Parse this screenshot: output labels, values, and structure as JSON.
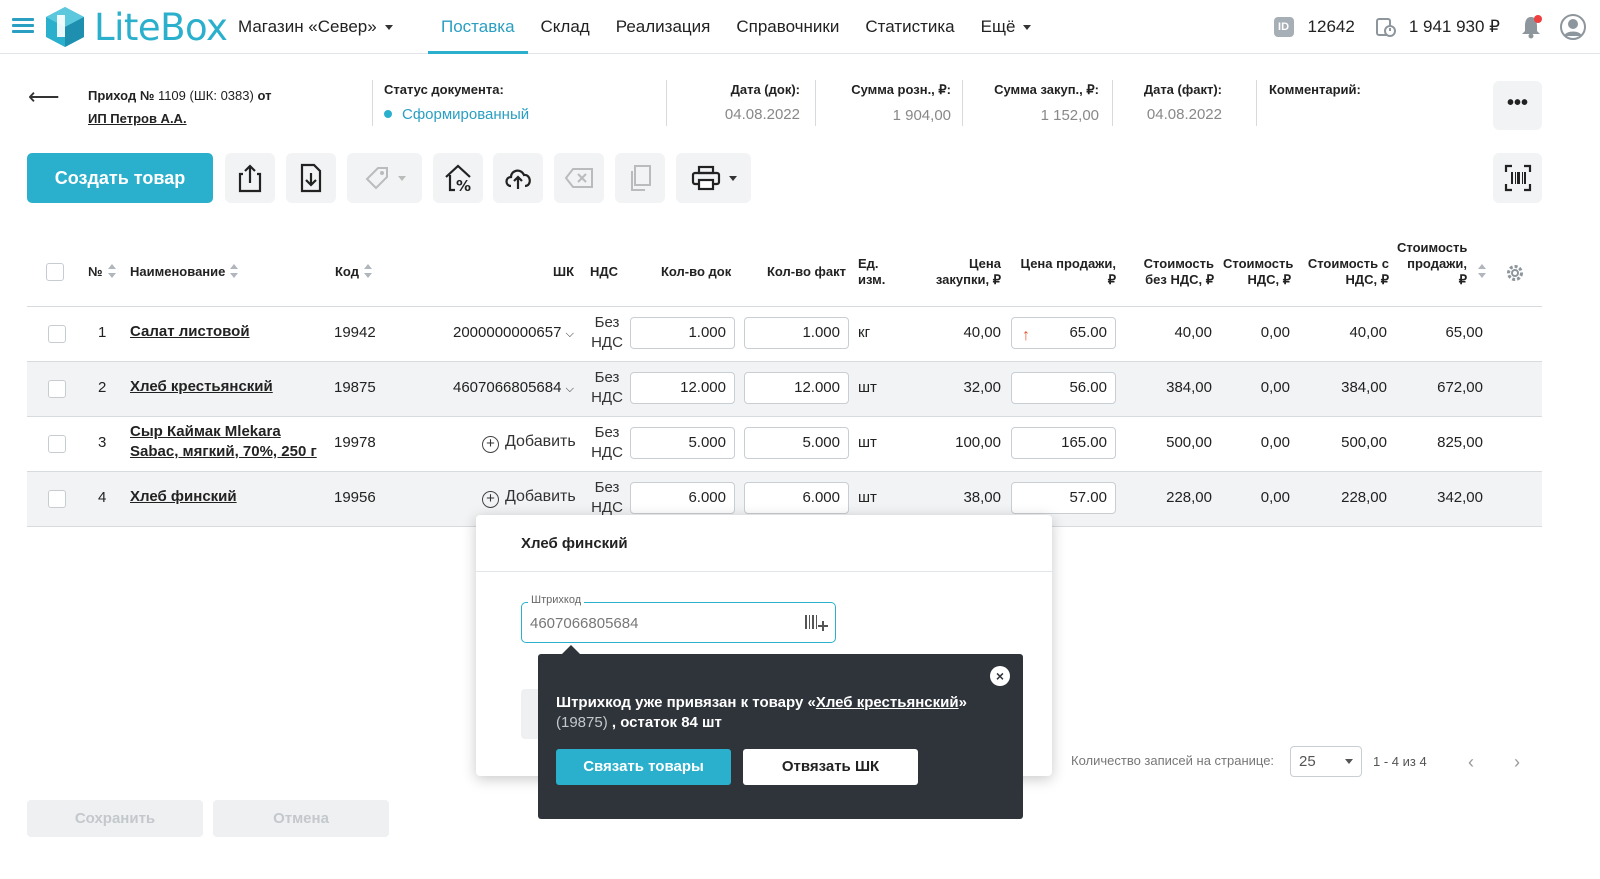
{
  "app": {
    "logo_text": "LiteBox",
    "store": "Магазин «Север»",
    "nav": [
      {
        "label": "Поставка",
        "active": true
      },
      {
        "label": "Склад"
      },
      {
        "label": "Реализация"
      },
      {
        "label": "Справочники"
      },
      {
        "label": "Статистика"
      },
      {
        "label": "Ещё"
      }
    ],
    "id_badge": "ID",
    "account_id": "12642",
    "balance": "1 941 930 ₽",
    "accent_color": "#2ab0cc"
  },
  "document": {
    "title_prefix": "Приход №",
    "number": "1109",
    "barcode_part": "(ШК: 0383)",
    "title_suffix": "от",
    "supplier": "ИП Петров А.А.",
    "status_label": "Статус документа:",
    "status_value": "Сформированный",
    "date_doc_label": "Дата (док):",
    "date_doc": "04.08.2022",
    "sum_retail_label": "Сумма розн., ₽:",
    "sum_retail": "1 904,00",
    "sum_purchase_label": "Сумма закуп., ₽:",
    "sum_purchase": "1 152,00",
    "date_fact_label": "Дата (факт):",
    "date_fact": "04.08.2022",
    "comment_label": "Комментарий:",
    "more_label": "•••"
  },
  "toolbar": {
    "create_label": "Создать товар"
  },
  "table": {
    "headers": {
      "num": "№",
      "name": "Наименование",
      "code": "Код",
      "barcode": "ШК",
      "vat": "НДС",
      "qty_doc": "Кол-во док",
      "qty_fact": "Кол-во факт",
      "unit": "Ед. изм.",
      "price_buy": "Цена закупки, ₽",
      "price_sell": "Цена продажи, ₽",
      "cost_no_vat": "Стоимость без НДС, ₽",
      "cost_vat": "Стоимость НДС, ₽",
      "cost_with_vat": "Стоимость с НДС, ₽",
      "cost_sell": "Стоимость продажи, ₽"
    },
    "add_label": "Добавить",
    "vat_text": "Без НДС",
    "rows": [
      {
        "num": "1",
        "name": "Салат листовой",
        "code": "19942",
        "barcode": "2000000000657",
        "qty_doc": "1.000",
        "qty_fact": "1.000",
        "unit": "кг",
        "price_buy": "40,00",
        "price_sell": "65.00",
        "price_up": true,
        "cost_no_vat": "40,00",
        "cost_vat": "0,00",
        "cost_with_vat": "40,00",
        "cost_sell": "65,00"
      },
      {
        "num": "2",
        "name": "Хлеб крестьянский",
        "code": "19875",
        "barcode": "4607066805684",
        "qty_doc": "12.000",
        "qty_fact": "12.000",
        "unit": "шт",
        "price_buy": "32,00",
        "price_sell": "56.00",
        "cost_no_vat": "384,00",
        "cost_vat": "0,00",
        "cost_with_vat": "384,00",
        "cost_sell": "672,00"
      },
      {
        "num": "3",
        "name": "Сыр Каймак Mlekara Sabac, мягкий, 70%, 250 г",
        "name_line1": "Сыр Каймак Mlekara",
        "name_line2": "Sabac, мягкий, 70%, 250 г",
        "code": "19978",
        "barcode": "",
        "qty_doc": "5.000",
        "qty_fact": "5.000",
        "unit": "шт",
        "price_buy": "100,00",
        "price_sell": "165.00",
        "cost_no_vat": "500,00",
        "cost_vat": "0,00",
        "cost_with_vat": "500,00",
        "cost_sell": "825,00"
      },
      {
        "num": "4",
        "name": "Хлеб финский",
        "code": "19956",
        "barcode": "",
        "qty_doc": "6.000",
        "qty_fact": "6.000",
        "unit": "шт",
        "price_buy": "38,00",
        "price_sell": "57.00",
        "cost_no_vat": "228,00",
        "cost_vat": "0,00",
        "cost_with_vat": "228,00",
        "cost_sell": "342,00"
      }
    ]
  },
  "pager": {
    "label": "Количество записей на странице:",
    "per_page": "25",
    "range": "1 - 4 из 4"
  },
  "footer": {
    "save_label": "Сохранить",
    "cancel_label": "Отмена"
  },
  "popup": {
    "title": "Хлеб финский",
    "barcode_label": "Штрихкод",
    "barcode_value": "4607066805684"
  },
  "tooltip": {
    "text_prefix": "Штрихкод уже привязан к товару «",
    "product_link": "Хлеб крестьянский",
    "text_suffix": "»",
    "code": "(19875)",
    "stock": ", остаток 84 шт",
    "link_label": "Связать товары",
    "unlink_label": "Отвязать ШК",
    "close_label": "×"
  }
}
